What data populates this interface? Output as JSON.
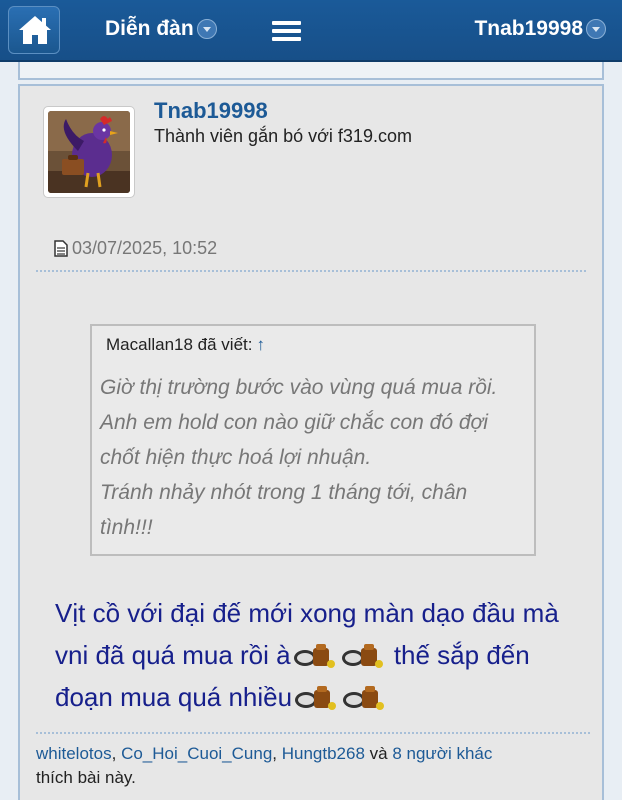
{
  "nav": {
    "forum_label": "Diễn đàn",
    "user_label": "Tnab19998"
  },
  "post": {
    "username": "Tnab19998",
    "user_title": "Thành viên gắn bó với f319.com",
    "date": "03/07/2025, 10:52",
    "quote": {
      "author_line": "Macallan18 đã viết:",
      "arrow": "↑",
      "lines": [
        "Giờ thị trường bước vào vùng quá mua rồi.",
        "Anh em hold con nào giữ chắc con đó đợi",
        "chốt hiện thực hoá lợi nhuận.",
        "Tránh nhảy nhót trong 1 tháng tới, chân",
        "tình!!!"
      ]
    },
    "message": {
      "part1": "Vịt cồ với đại đế mới xong màn dạo đầu mà vni đã quá mua rồi à",
      "part2": " thế sắp đến đoạn mua quá nhiều",
      "smiley_icon": "money-bag-smiley-icon"
    },
    "likes": {
      "users": [
        "whitelotos",
        "Co_Hoi_Cuoi_Cung",
        "Hungtb268"
      ],
      "sep1": ", ",
      "sep2": ", ",
      "and_text": " và ",
      "others": "8 người khác",
      "tail": "thích bài này."
    }
  },
  "colors": {
    "nav_bg": "#1a5a99",
    "link": "#1d5a96",
    "message_text": "#17208c",
    "quote_text": "#777777"
  }
}
